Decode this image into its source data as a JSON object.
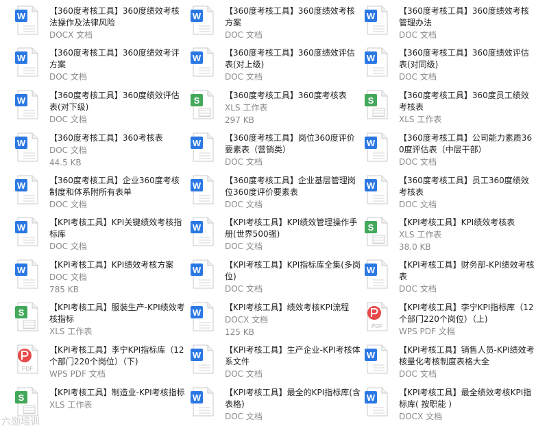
{
  "files": [
    {
      "title": "【360度考核工具】360度绩效考核法操作及法律风险",
      "type": "DOCX 文档",
      "icon": "word-document-icon"
    },
    {
      "title": "【360度考核工具】360度绩效考核方案",
      "type": "DOC 文档",
      "icon": "word-document-icon"
    },
    {
      "title": "【360度考核工具】360度绩效考核管理办法",
      "type": "DOC 文档",
      "icon": "word-document-icon"
    },
    {
      "title": "【360度考核工具】360度绩效考评方案",
      "type": "DOC 文档",
      "icon": "word-document-icon"
    },
    {
      "title": "【360度考核工具】360度绩效评估表(对上级)",
      "type": "DOC 文档",
      "icon": "word-document-icon"
    },
    {
      "title": "【360度考核工具】360度绩效评估表(对同级)",
      "type": "DOC 文档",
      "icon": "word-document-icon"
    },
    {
      "title": "【360度考核工具】360度绩效评估表(对下级)",
      "type": "DOC 文档",
      "icon": "word-document-icon"
    },
    {
      "title": "【360度考核工具】360度考核表",
      "type": "XLS 工作表",
      "size": "297 KB",
      "icon": "excel-sheet-icon"
    },
    {
      "title": "【360度考核工具】360度员工绩效考核表",
      "type": "XLS 工作表",
      "icon": "excel-sheet-icon"
    },
    {
      "title": "【360度考核工具】360考核表",
      "type": "DOC 文档",
      "size": "44.5 KB",
      "icon": "word-document-icon"
    },
    {
      "title": "【360度考核工具】岗位360度评价要素表（营销类）",
      "type": "DOC 文档",
      "icon": "word-document-icon"
    },
    {
      "title": "【360度考核工具】公司能力素质360度评估表（中层干部）",
      "type": "DOC 文档",
      "icon": "word-document-icon"
    },
    {
      "title": "【360度考核工具】企业360度考核制度和体系附所有表单",
      "type": "DOC 文档",
      "icon": "word-document-icon"
    },
    {
      "title": "【360度考核工具】企业基层管理岗位360度评价要素表",
      "type": "DOC 文档",
      "icon": "word-document-icon"
    },
    {
      "title": "【360度考核工具】员工360度绩效考核表",
      "type": "DOC 文档",
      "icon": "word-document-icon"
    },
    {
      "title": "【KPI考核工具】KPI关键绩效考核指标库",
      "type": "DOC 文档",
      "icon": "word-document-icon"
    },
    {
      "title": "【KPI考核工具】KPI绩效管理操作手册(世界500强)",
      "type": "DOC 文档",
      "icon": "word-document-icon"
    },
    {
      "title": "【KPI考核工具】KPI绩效考核表",
      "type": "XLS 工作表",
      "size": "38.0 KB",
      "icon": "excel-sheet-icon"
    },
    {
      "title": "【KPI考核工具】KPI绩效考核方案",
      "type": "DOC 文档",
      "size": "785 KB",
      "icon": "word-document-icon"
    },
    {
      "title": "【KPI考核工具】KPI指标库全集(多岗位)",
      "type": "DOC 文档",
      "icon": "word-document-icon"
    },
    {
      "title": "【KPI考核工具】财务部-KPI绩效考核表",
      "type": "DOC 文档",
      "icon": "word-document-icon"
    },
    {
      "title": "【KPI考核工具】服装生产-KPI绩效考核指标",
      "type": "XLS 工作表",
      "icon": "excel-sheet-icon"
    },
    {
      "title": "【KPI考核工具】绩效考核KPI流程",
      "type": "DOCX 文档",
      "size": "125 KB",
      "icon": "word-document-icon"
    },
    {
      "title": "【KPI考核工具】李宁KPI指标库（12个部门220个岗位）（上)",
      "type": "WPS PDF 文档",
      "icon": "pdf-document-icon"
    },
    {
      "title": "【KPI考核工具】李宁KPI指标库（12个部门220个岗位）（下)",
      "type": "WPS PDF 文档",
      "icon": "pdf-document-icon"
    },
    {
      "title": "【KPI考核工具】生产企业-KPI考核体系文件",
      "type": "DOC 文档",
      "icon": "word-document-icon"
    },
    {
      "title": "【KPI考核工具】销售人员-KPI绩效考核量化考核制度表格大全",
      "type": "DOC 文档",
      "icon": "word-document-icon"
    },
    {
      "title": "【KPI考核工具】制造业-KPI考核指标",
      "type": "XLS 工作表",
      "icon": "excel-sheet-icon"
    },
    {
      "title": "【KPI考核工具】最全的KPI指标库(含表格)",
      "type": "DOC 文档",
      "icon": "word-document-icon"
    },
    {
      "title": "【KPI考核工具】最全绩效考核KPI指标库( 按职能 )",
      "type": "DOCX 文档",
      "icon": "word-document-icon"
    }
  ],
  "colors": {
    "word": "#2b78e4",
    "excel": "#43a85a",
    "pdf": "#e84a4a"
  },
  "watermark": "六勋培训"
}
